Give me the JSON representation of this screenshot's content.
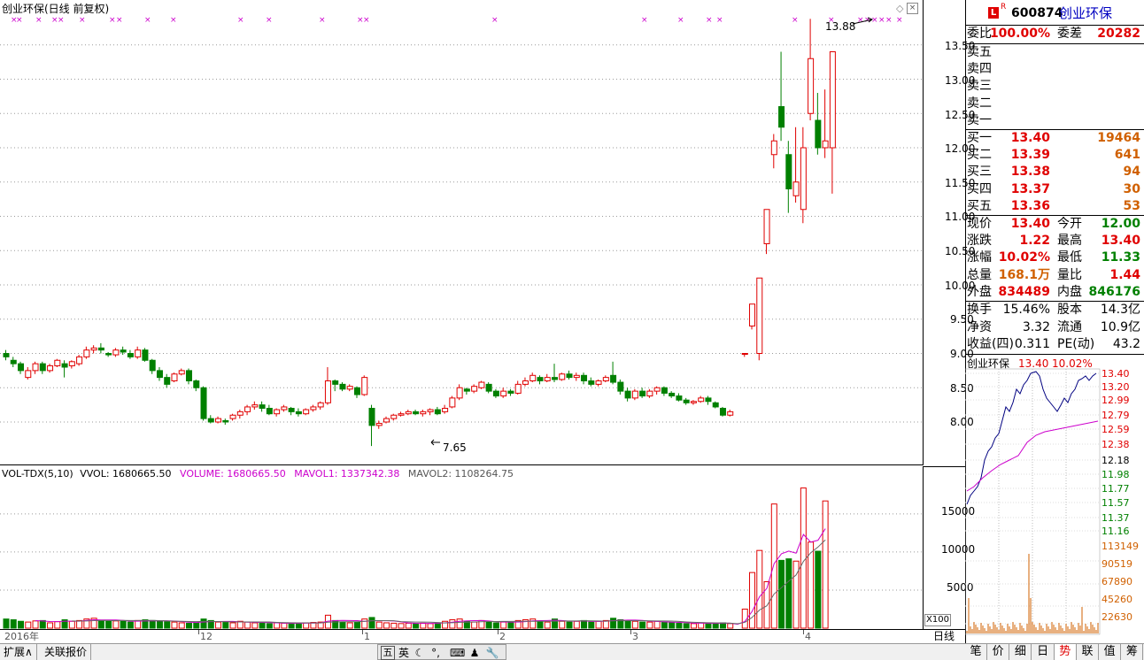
{
  "main_chart": {
    "title": "创业环保(日线 前复权)",
    "high_label": "13.88",
    "low_label": "7.65",
    "y_ticks": [
      "13.50",
      "13.00",
      "12.50",
      "12.00",
      "11.50",
      "11.00",
      "10.50",
      "10.00",
      "9.50",
      "9.00",
      "8.50",
      "8.00"
    ]
  },
  "vol_chart": {
    "indicator": "VOL-TDX(5,10)",
    "vvol": "VVOL: 1680665.50",
    "volume": "VOLUME: 1680665.50",
    "mavol1": "MAVOL1: 1337342.38",
    "mavol2": "MAVOL2: 1108264.75",
    "y_ticks": [
      "15000",
      "10000",
      "5000"
    ],
    "multiplier": "X100"
  },
  "x_axis": {
    "labels": [
      "2016年",
      "12",
      "1",
      "2",
      "3",
      "4"
    ],
    "period": "日线"
  },
  "quote": {
    "code": "600874",
    "name": "创业环保",
    "badge": "L",
    "badge_sup": "R",
    "weibi_label": "委比",
    "weibi": "100.00%",
    "weicha_label": "委差",
    "weicha": "20282",
    "sell": [
      {
        "label": "卖五"
      },
      {
        "label": "卖四"
      },
      {
        "label": "卖三"
      },
      {
        "label": "卖二"
      },
      {
        "label": "卖一"
      }
    ],
    "buy": [
      {
        "label": "买一",
        "price": "13.40",
        "vol": "19464"
      },
      {
        "label": "买二",
        "price": "13.39",
        "vol": "641"
      },
      {
        "label": "买三",
        "price": "13.38",
        "vol": "94"
      },
      {
        "label": "买四",
        "price": "13.37",
        "vol": "30"
      },
      {
        "label": "买五",
        "price": "13.36",
        "vol": "53"
      }
    ],
    "stats": [
      {
        "l1": "现价",
        "v1": "13.40",
        "l2": "今开",
        "v2": "12.00",
        "c1": "red",
        "c2": "grn"
      },
      {
        "l1": "涨跌",
        "v1": "1.22",
        "l2": "最高",
        "v2": "13.40",
        "c1": "red",
        "c2": "red"
      },
      {
        "l1": "涨幅",
        "v1": "10.02%",
        "l2": "最低",
        "v2": "11.33",
        "c1": "red",
        "c2": "grn"
      },
      {
        "l1": "总量",
        "v1": "168.1万",
        "l2": "量比",
        "v2": "1.44",
        "c1": "org",
        "c2": "red"
      },
      {
        "l1": "外盘",
        "v1": "834489",
        "l2": "内盘",
        "v2": "846176",
        "c1": "red",
        "c2": "grn"
      }
    ],
    "fin": [
      {
        "l1": "换手",
        "v1": "15.46%",
        "l2": "股本",
        "v2": "14.3亿"
      },
      {
        "l1": "净资",
        "v1": "3.32",
        "l2": "流通",
        "v2": "10.9亿"
      },
      {
        "l1": "收益(四)",
        "v1": "0.311",
        "l2": "PE(动)",
        "v2": "43.2"
      }
    ]
  },
  "mini": {
    "name": "创业环保",
    "price": "13.40",
    "pct": "10.02%",
    "price_ticks": [
      "13.40",
      "13.20",
      "12.99",
      "12.79",
      "12.59",
      "12.38",
      "12.18",
      "11.98",
      "11.77",
      "11.57",
      "11.37",
      "11.16"
    ],
    "vol_ticks": [
      "113149",
      "90519",
      "67890",
      "45260",
      "22630"
    ]
  },
  "bottom": {
    "tab1": "扩展∧",
    "tab2": "关联报价",
    "ime": "五",
    "ime2": "英"
  },
  "rtabs": [
    "笔",
    "价",
    "细",
    "日",
    "势",
    "联",
    "值",
    "筹"
  ],
  "colors": {
    "up": "#e00000",
    "down": "#008000",
    "ma1": "#cc00cc",
    "ma_blue": "#0000c0"
  }
}
